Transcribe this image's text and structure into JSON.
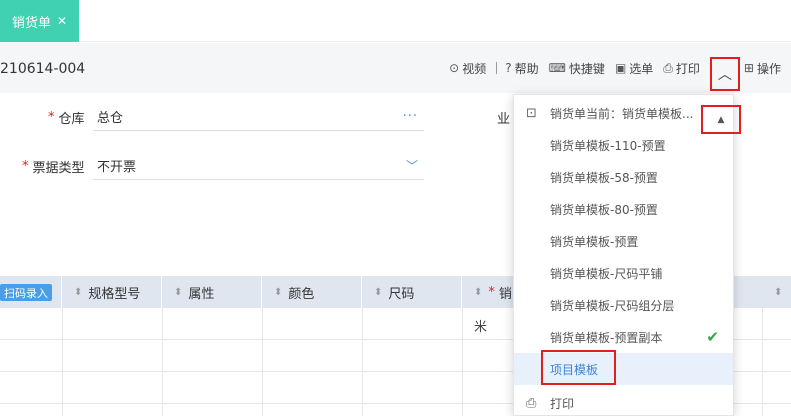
{
  "tabs": {
    "active_label": "销货单",
    "close_glyph": "✕"
  },
  "toolbar": {
    "doc_no": "210614-004",
    "video": "视频",
    "help": "帮助",
    "shortcut": "快捷键",
    "select_doc": "选单",
    "print": "打印",
    "operate": "操作"
  },
  "form": {
    "warehouse_label": "仓库",
    "warehouse_value": "总仓",
    "bill_type_label": "票据类型",
    "bill_type_value": "不开票",
    "business_label_partial": "业"
  },
  "grid": {
    "scan_button": "扫码录入",
    "headers": [
      "规格型号",
      "属性",
      "颜色",
      "尺码",
      "销"
    ],
    "cell_sample": "米"
  },
  "print_menu": {
    "current": "销货单当前：销货单模板...",
    "items": [
      "销货单模板-110-预置",
      "销货单模板-58-预置",
      "销货单模板-80-预置",
      "销货单模板-预置",
      "销货单模板-尺码平铺",
      "销货单模板-尺码组分层",
      "销货单模板-预置副本",
      "项目模板",
      "打印"
    ]
  },
  "colors": {
    "tab_active": "#3fd1b1",
    "accent_blue": "#4a90d9",
    "highlight_red": "#e02020",
    "check_green": "#2aa84a"
  }
}
